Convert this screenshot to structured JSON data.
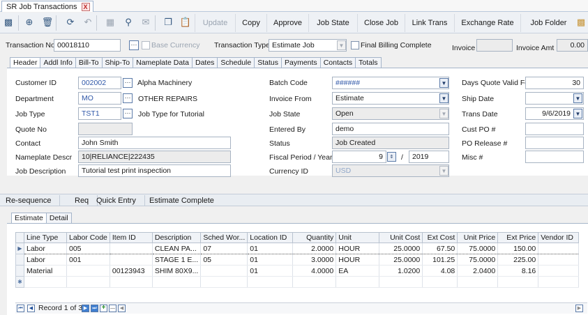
{
  "window": {
    "doc_tab_title": "SR Job Transactions",
    "close_glyph": "X"
  },
  "toolbar": {
    "buttons": [
      "Update",
      "Copy",
      "Approve",
      "Job State",
      "Close Job",
      "Link Trans",
      "Exchange Rate",
      "Job Folder"
    ],
    "icons": [
      "save-icon",
      "add-icon",
      "delete-icon",
      "refresh-icon",
      "undo-icon",
      "print-preview-icon",
      "attachment-icon",
      "email-icon",
      "copy-icon",
      "paste-icon",
      "folder-icon"
    ]
  },
  "top": {
    "transaction_no_label": "Transaction No",
    "transaction_no_value": "00018110",
    "base_currency_label": "Base Currency",
    "transaction_type_label": "Transaction Type",
    "transaction_type_value": "Estimate Job",
    "final_billing_label": "Final Billing Complete",
    "invoice_label": "Invoice",
    "invoice_amt_label": "Invoice Amt",
    "invoice_amt_value": "0.00"
  },
  "header_tabs": [
    "Header",
    "Addl Info",
    "Bill-To",
    "Ship-To",
    "Nameplate Data",
    "Dates",
    "Schedule",
    "Status",
    "Payments",
    "Contacts",
    "Totals"
  ],
  "header": {
    "customer_id_label": "Customer ID",
    "customer_id_value": "002002",
    "customer_name": "Alpha Machinery",
    "department_label": "Department",
    "department_value": "MO",
    "department_name": "OTHER REPAIRS",
    "job_type_label": "Job Type",
    "job_type_value": "TST1",
    "job_type_name": "Job Type for Tutorial",
    "quote_no_label": "Quote No",
    "quote_no_value": "",
    "contact_label": "Contact",
    "contact_value": "John Smith",
    "nameplate_label": "Nameplate Descr",
    "nameplate_value": "10|RELIANCE|222435",
    "job_desc_label": "Job Description",
    "job_desc_value": "Tutorial test print inspection",
    "batch_code_label": "Batch Code",
    "batch_code_value": "######",
    "invoice_from_label": "Invoice From",
    "invoice_from_value": "Estimate",
    "job_state_label": "Job State",
    "job_state_value": "Open",
    "entered_by_label": "Entered By",
    "entered_by_value": "demo",
    "status_label": "Status",
    "status_value": "Job Created",
    "fiscal_label": "Fiscal Period / Year",
    "fiscal_period": "9",
    "fiscal_sep": "/",
    "fiscal_year": "2019",
    "currency_label": "Currency ID",
    "currency_value": "USD",
    "days_quote_label": "Days Quote Valid For",
    "days_quote_value": "30",
    "ship_date_label": "Ship Date",
    "ship_date_value": "",
    "trans_date_label": "Trans Date",
    "trans_date_value": "9/6/2019",
    "cust_po_label": "Cust PO #",
    "cust_po_value": "",
    "po_release_label": "PO Release #",
    "po_release_value": "",
    "misc_label": "Misc #",
    "misc_value": ""
  },
  "actions": [
    "Re-sequence",
    "Req",
    "Quick Entry",
    "Estimate Complete"
  ],
  "grid_tabs": [
    "Estimate",
    "Detail"
  ],
  "grid": {
    "columns": [
      "Line Type",
      "Labor Code",
      "Item ID",
      "Description",
      "Sched Wor...",
      "Location ID",
      "Quantity",
      "Unit",
      "Unit Cost",
      "Ext Cost",
      "Unit Price",
      "Ext Price",
      "Vendor ID"
    ],
    "rows": [
      [
        "Labor",
        "005",
        "",
        "CLEAN PA...",
        "07",
        "01",
        "2.0000",
        "HOUR",
        "25.0000",
        "67.50",
        "75.0000",
        "150.00",
        ""
      ],
      [
        "Labor",
        "001",
        "",
        "STAGE 1 E...",
        "05",
        "01",
        "3.0000",
        "HOUR",
        "25.0000",
        "101.25",
        "75.0000",
        "225.00",
        ""
      ],
      [
        "Material",
        "",
        "00123943",
        "SHIM 80X9...",
        "",
        "01",
        "4.0000",
        "EA",
        "1.0200",
        "4.08",
        "2.0400",
        "8.16",
        ""
      ]
    ],
    "record_text": "Record 1 of 3"
  }
}
